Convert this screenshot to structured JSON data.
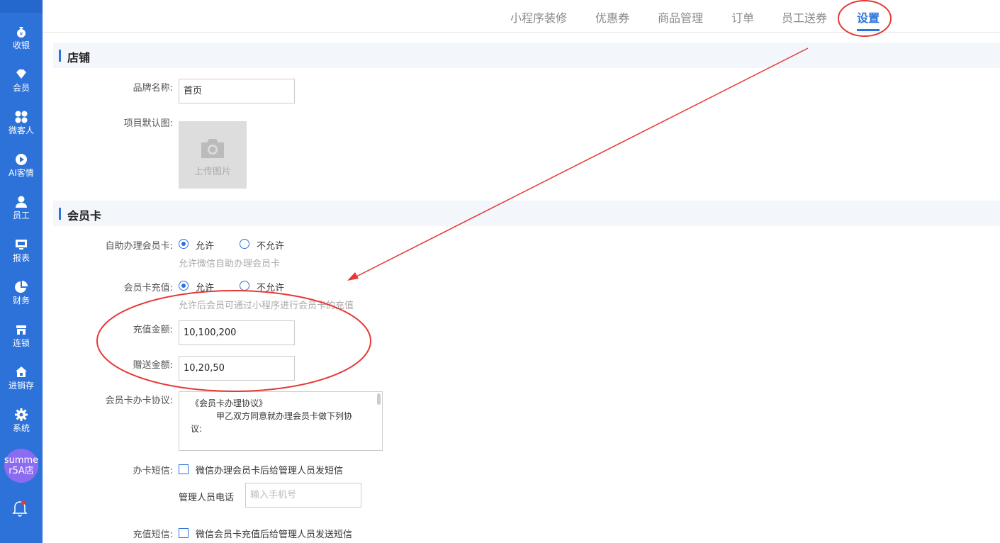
{
  "sidebar": {
    "items": [
      {
        "label": "收银",
        "icon": "money-bag-icon"
      },
      {
        "label": "会员",
        "icon": "diamond-icon"
      },
      {
        "label": "微客人",
        "icon": "grid-icon"
      },
      {
        "label": "AI客情",
        "icon": "play-circle-icon"
      },
      {
        "label": "员工",
        "icon": "user-icon"
      },
      {
        "label": "报表",
        "icon": "monitor-icon"
      },
      {
        "label": "财务",
        "icon": "pie-chart-icon"
      },
      {
        "label": "连锁",
        "icon": "store-icon"
      },
      {
        "label": "进销存",
        "icon": "home-icon"
      },
      {
        "label": "系统",
        "icon": "gear-icon"
      }
    ],
    "avatar_text_line1": "summe",
    "avatar_text_line2": "r5A店"
  },
  "tabs": [
    {
      "label": "小程序装修"
    },
    {
      "label": "优惠券"
    },
    {
      "label": "商品管理"
    },
    {
      "label": "订单"
    },
    {
      "label": "员工送券"
    },
    {
      "label": "设置",
      "active": true
    }
  ],
  "store_section": {
    "title": "店铺",
    "brand_label": "品牌名称:",
    "brand_value": "首页",
    "default_image_label": "项目默认图:",
    "upload_text": "上传图片"
  },
  "card_section": {
    "title": "会员卡",
    "self_apply_label": "自助办理会员卡:",
    "allow": "允许",
    "disallow": "不允许",
    "self_apply_hint": "允许微信自助办理会员卡",
    "recharge_label": "会员卡充值:",
    "recharge_hint": "允许后会员可通过小程序进行会员卡的充值",
    "amount_label": "充值金额:",
    "amount_value": "10,100,200",
    "bonus_label": "赠送金额:",
    "bonus_value": "10,20,50",
    "agreement_label": "会员卡办卡协议:",
    "agreement_line1": "《会员卡办理协议》",
    "agreement_line2": "甲乙双方同意就办理会员卡做下列协",
    "agreement_line3": "议:",
    "sms_label": "办卡短信:",
    "sms_text": "微信办理会员卡后给管理人员发短信",
    "phone_label": "管理人员电话",
    "phone_placeholder": "输入手机号",
    "recharge_sms_label": "充值短信:",
    "recharge_sms_text": "微信会员卡充值后给管理人员发送短信"
  },
  "colors": {
    "primary": "#2d72d9",
    "annotation": "#e53935"
  }
}
